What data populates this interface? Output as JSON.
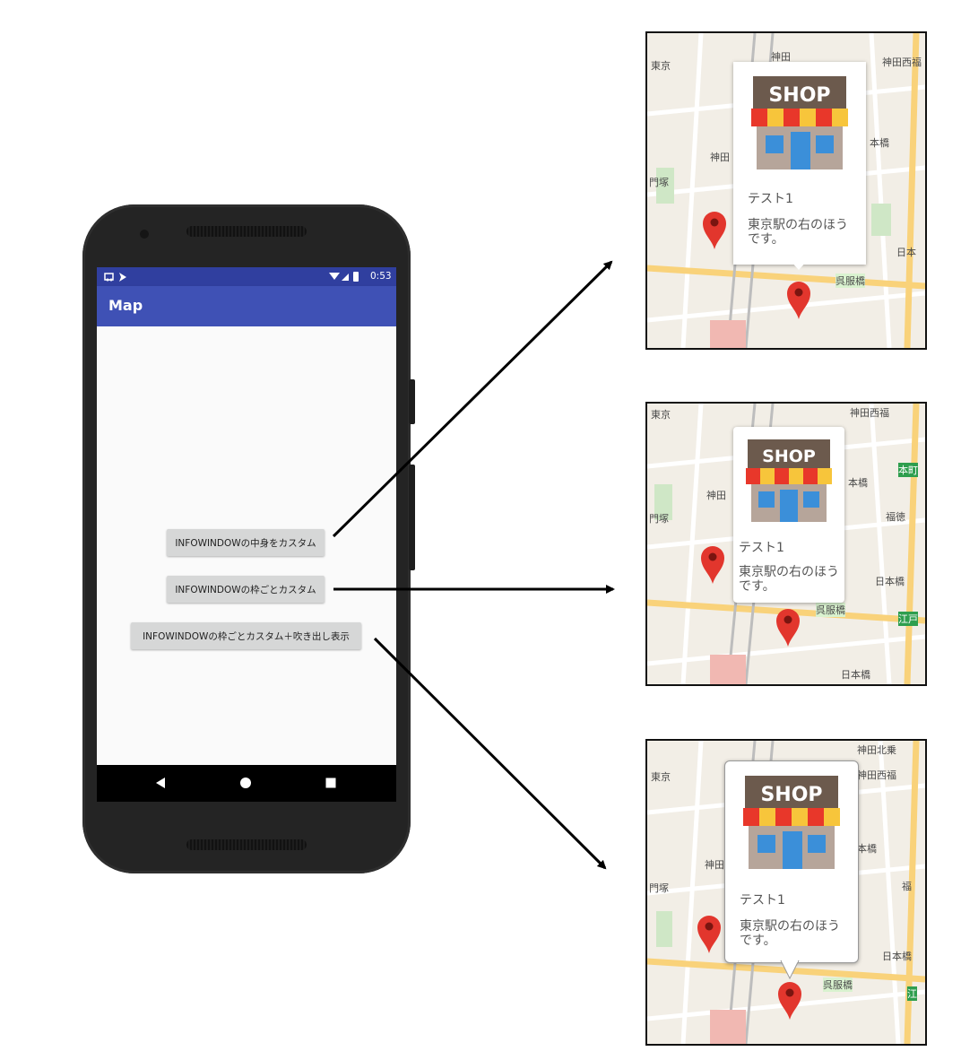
{
  "phone": {
    "status_bar": {
      "time": "0:53"
    },
    "app_bar": {
      "title": "Map"
    },
    "buttons": [
      {
        "label": "INFOWINDOWの中身をカスタム"
      },
      {
        "label": "INFOWINDOWの枠ごとカスタム"
      },
      {
        "label": "INFOWINDOWの枠ごとカスタム＋吹き出し表示"
      }
    ],
    "nav_bar": {
      "icons": [
        "back-icon",
        "home-icon",
        "recents-icon"
      ]
    }
  },
  "panels": [
    {
      "map_labels": [
        "神田",
        "東京",
        "神田西福",
        "本橋",
        "神田",
        "門塚",
        "日本",
        "呉服橋"
      ],
      "card": {
        "shop_sign": "SHOP",
        "name": "テスト1",
        "description": "東京駅の右のほうです。"
      }
    },
    {
      "map_labels": [
        "東京",
        "神田西福",
        "本橋",
        "神田",
        "門塚",
        "福徳",
        "日本橋",
        "呉服橋",
        "日本橋",
        "江戸",
        "本町"
      ],
      "card": {
        "shop_sign": "SHOP",
        "name": "テスト1",
        "description": "東京駅の右のほうです。"
      }
    },
    {
      "map_labels": [
        "神田北乗",
        "東京",
        "神田西福",
        "本橋",
        "神田",
        "門塚",
        "福",
        "日本橋",
        "呉服橋",
        "江"
      ],
      "card": {
        "shop_sign": "SHOP",
        "name": "テスト1",
        "description": "東京駅の右のほうです。"
      }
    }
  ],
  "colors": {
    "status_bar": "#303f9f",
    "app_bar": "#3f51b5",
    "button": "#d6d7d7",
    "pin": "#e2362d",
    "map_bg": "#f4efe6"
  }
}
